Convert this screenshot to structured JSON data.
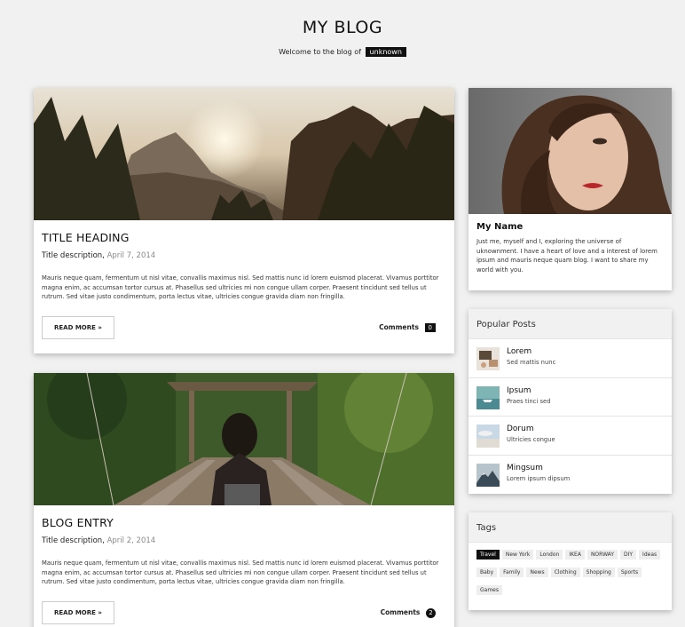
{
  "header": {
    "title": "MY BLOG",
    "tagline_prefix": "Welcome to the blog of",
    "tagline_name": "unknown"
  },
  "posts": [
    {
      "title": "TITLE HEADING",
      "description": "Title description,",
      "date": "April 7, 2014",
      "text": "Mauris neque quam, fermentum ut nisl vitae, convallis maximus nisl. Sed mattis nunc id lorem euismod placerat. Vivamus porttitor magna enim, ac accumsan tortor cursus at. Phasellus sed ultricies mi non congue ullam corper. Praesent tincidunt sed tellus ut rutrum. Sed vitae justo condimentum, porta lectus vitae, ultricies congue gravida diam non fringilla.",
      "read_more": "READ MORE »",
      "comments_label": "Comments",
      "comments_count": "0",
      "image": "mountain-sunset"
    },
    {
      "title": "BLOG ENTRY",
      "description": "Title description,",
      "date": "April 2, 2014",
      "text": "Mauris neque quam, fermentum ut nisl vitae, convallis maximus nisl. Sed mattis nunc id lorem euismod placerat. Vivamus porttitor magna enim, ac accumsan tortor cursus at. Phasellus sed ultricies mi non congue ullam corper. Praesent tincidunt sed tellus ut rutrum. Sed vitae justo condimentum, porta lectus vitae, ultricies congue gravida diam non fringilla.",
      "read_more": "READ MORE »",
      "comments_label": "Comments",
      "comments_count": "2",
      "image": "woman-on-bridge"
    }
  ],
  "profile": {
    "name": "My Name",
    "bio": "Just me, myself and I, exploring the universe of uknownment. I have a heart of love and a interest of lorem ipsum and mauris neque quam blog. I want to share my world with you.",
    "image": "woman-portrait"
  },
  "popular": {
    "heading": "Popular Posts",
    "items": [
      {
        "title": "Lorem",
        "subtitle": "Sed mattis nunc",
        "thumb": "workspace"
      },
      {
        "title": "Ipsum",
        "subtitle": "Praes tinci sed",
        "thumb": "boat"
      },
      {
        "title": "Dorum",
        "subtitle": "Ultricies congue",
        "thumb": "sky"
      },
      {
        "title": "Mingsum",
        "subtitle": "Lorem ipsum dipsum",
        "thumb": "mountain"
      }
    ]
  },
  "tags": {
    "heading": "Tags",
    "items": [
      "Travel",
      "New York",
      "London",
      "IKEA",
      "NORWAY",
      "DIY",
      "Ideas",
      "Baby",
      "Family",
      "News",
      "Clothing",
      "Shopping",
      "Sports",
      "Games"
    ],
    "active": "Travel"
  },
  "colors": {
    "background": "#f1f1f1",
    "accent": "#111111"
  }
}
